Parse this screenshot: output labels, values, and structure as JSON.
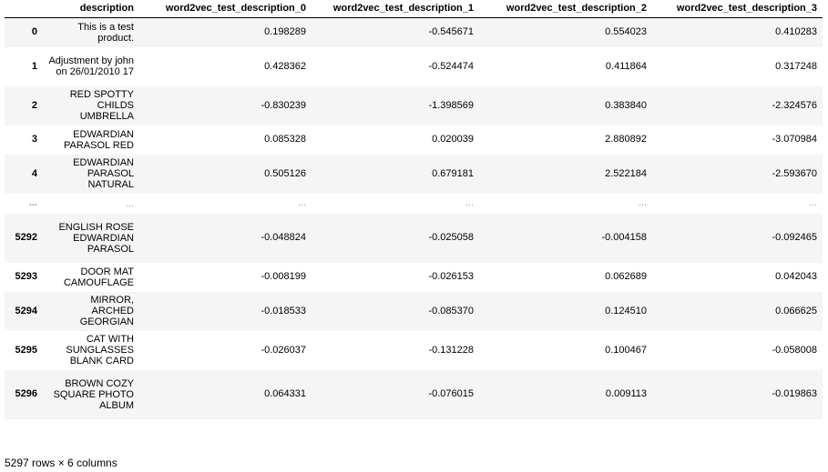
{
  "table": {
    "columns": [
      "",
      "description",
      "word2vec_test_description_0",
      "word2vec_test_description_1",
      "word2vec_test_description_2",
      "word2vec_test_description_3"
    ],
    "rows": [
      {
        "index": "0",
        "description": "This is a test product.",
        "v0": "0.198289",
        "v1": "-0.545671",
        "v2": "0.554023",
        "v3": "0.410283"
      },
      {
        "index": "1",
        "description": "Adjustment by john on 26/01/2010 17",
        "v0": "0.428362",
        "v1": "-0.524474",
        "v2": "0.411864",
        "v3": "0.317248"
      },
      {
        "index": "2",
        "description": "RED SPOTTY CHILDS UMBRELLA",
        "v0": "-0.830239",
        "v1": "-1.398569",
        "v2": "0.383840",
        "v3": "-2.324576"
      },
      {
        "index": "3",
        "description": "EDWARDIAN PARASOL RED",
        "v0": "0.085328",
        "v1": "0.020039",
        "v2": "2.880892",
        "v3": "-3.070984"
      },
      {
        "index": "4",
        "description": "EDWARDIAN PARASOL NATURAL",
        "v0": "0.505126",
        "v1": "0.679181",
        "v2": "2.522184",
        "v3": "-2.593670"
      },
      {
        "index": "...",
        "description": "...",
        "v0": "...",
        "v1": "...",
        "v2": "...",
        "v3": "...",
        "ellipsis": true
      },
      {
        "index": "5292",
        "description": "ENGLISH ROSE EDWARDIAN PARASOL",
        "v0": "-0.048824",
        "v1": "-0.025058",
        "v2": "-0.004158",
        "v3": "-0.092465"
      },
      {
        "index": "5293",
        "description": "DOOR MAT CAMOUFLAGE",
        "v0": "-0.008199",
        "v1": "-0.026153",
        "v2": "0.062689",
        "v3": "0.042043"
      },
      {
        "index": "5294",
        "description": "MIRROR, ARCHED GEORGIAN",
        "v0": "-0.018533",
        "v1": "-0.085370",
        "v2": "0.124510",
        "v3": "0.066625"
      },
      {
        "index": "5295",
        "description": "CAT WITH SUNGLASSES BLANK CARD",
        "v0": "-0.026037",
        "v1": "-0.131228",
        "v2": "0.100467",
        "v3": "-0.058008"
      },
      {
        "index": "5296",
        "description": "BROWN COZY SQUARE PHOTO ALBUM",
        "v0": "0.064331",
        "v1": "-0.076015",
        "v2": "0.009113",
        "v3": "-0.019863"
      }
    ]
  },
  "caption": "5297 rows × 6 columns",
  "colors": {
    "stripe": "#f5f5f5",
    "header_border": "#000000",
    "ellipsis_text": "#999999"
  }
}
